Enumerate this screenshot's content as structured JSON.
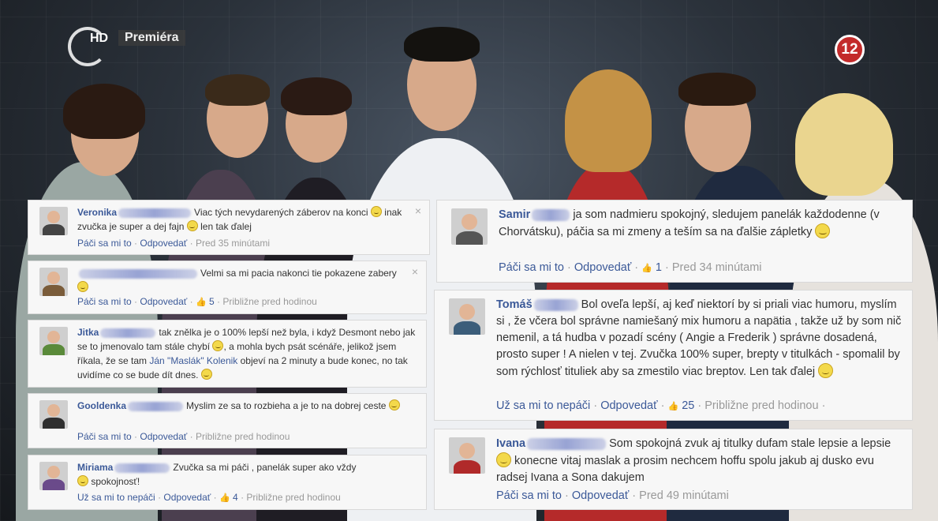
{
  "overlay": {
    "channel_label": "HD",
    "premiere_label": "Premiéra",
    "age_rating": "12"
  },
  "comments": [
    {
      "name": "Veronika",
      "text_a": "Viac tých nevydarených záberov na konci",
      "text_b": "inak zvučka je super a dej fajn",
      "text_c": "len tak ďalej",
      "like": "Páči sa mi to",
      "reply": "Odpovedať",
      "time": "Pred 35 minútami",
      "avatar_color": "#444444"
    },
    {
      "name": "",
      "text_a": "Velmi sa mi pacia nakonci tie pokazene zabery",
      "like": "Páči sa mi to",
      "reply": "Odpovedať",
      "count": "5",
      "time": "Približne pred hodinou",
      "avatar_color": "#7a5c3a"
    },
    {
      "name": "Jitka",
      "text_a": "tak znělka je o 100% lepší než byla, i když Desmont nebo jak se to jmenovalo tam stále chybí",
      "text_b": ", a mohla bych psát scénáře, jelikož jsem říkala, že se tam",
      "mention": "Ján \"Maslák\" Kolenik",
      "text_c": "objeví na 2 minuty a bude konec, no tak uvidíme co se bude dít dnes.",
      "avatar_color": "#5a8a3a"
    },
    {
      "name": "Gooldenka",
      "text_a": "Myslim ze sa to rozbieha a je to na dobrej ceste",
      "like": "Páči sa mi to",
      "reply": "Odpovedať",
      "time": "Približne pred hodinou",
      "avatar_color": "#2f2f2f"
    },
    {
      "name": "Miriama",
      "text_a": "Zvučka sa mi páči , panelák super ako vždy",
      "text_b": "spokojnosť!",
      "like": "Už sa mi to nepáči",
      "reply": "Odpovedať",
      "count": "4",
      "time": "Približne pred hodinou",
      "avatar_color": "#6a4a8a"
    },
    {
      "name": "Samir",
      "text_a": "ja som nadmieru spokojný, sledujem panelák každodenne (v Chorvátsku), páčia sa mi zmeny a teším sa na ďalšie zápletky",
      "like": "Páči sa mi to",
      "reply": "Odpovedať",
      "count": "1",
      "time": "Pred 34 minútami",
      "avatar_color": "#555555"
    },
    {
      "name": "Tomáš",
      "text_a": "Bol oveľa lepší, aj keď niektorí by si priali viac humoru, myslím si , že včera bol správne namiešaný mix humoru a napätia , takže už by som nič nemenil, a tá hudba v pozadí scény ( Angie a Frederik ) správne dosadená, prosto super ! A nielen v tej. Zvučka 100% super, brepty v titulkách - spomalil by som rýchlosť tituliek aby sa zmestilo viac breptov. Len tak ďalej",
      "like": "Už sa mi to nepáči",
      "reply": "Odpovedať",
      "count": "25",
      "time": "Približne pred hodinou",
      "avatar_color": "#3b5d7a"
    },
    {
      "name": "Ivana",
      "text_a": "Som spokojná zvuk aj titulky dufam stale lepsie a lepsie",
      "text_b": "konecne vitaj maslak a prosim nechcem hoffu spolu jakub aj dusko evu radsej Ivana a Sona dakujem",
      "like": "Páči sa mi to",
      "reply": "Odpovedať",
      "time": "Pred 49 minútami",
      "avatar_color": "#b02a2a"
    }
  ],
  "sep": "·",
  "close_glyph": "×",
  "like_glyph": "👍"
}
